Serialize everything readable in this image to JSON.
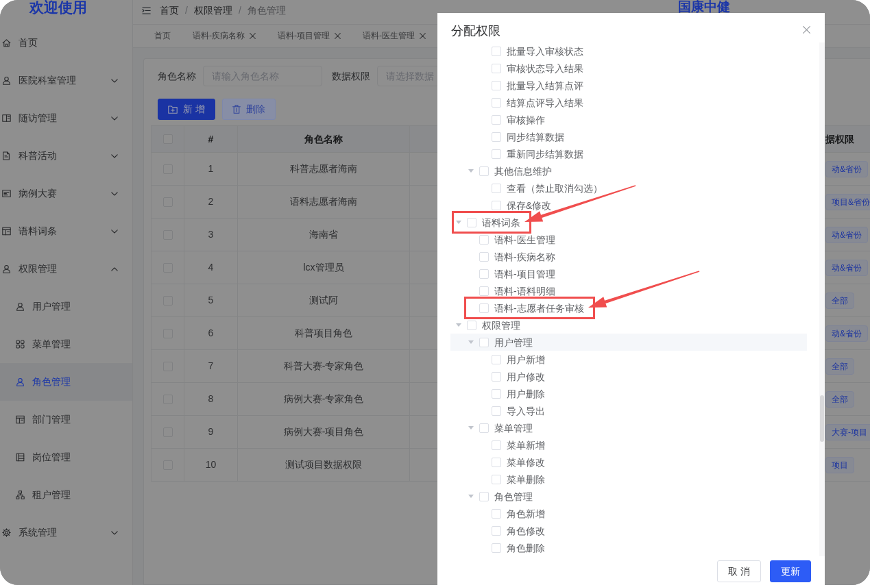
{
  "sidebar": {
    "logo": "欢迎使用",
    "items": [
      {
        "label": "首页",
        "selected": false
      },
      {
        "label": "医院科室管理",
        "expanded": false,
        "selected": false
      },
      {
        "label": "随访管理",
        "expanded": false,
        "selected": false
      },
      {
        "label": "科普活动",
        "expanded": false,
        "selected": false
      },
      {
        "label": "病例大赛",
        "expanded": false,
        "selected": false
      },
      {
        "label": "语料词条",
        "expanded": false,
        "selected": false
      },
      {
        "label": "权限管理",
        "expanded": true,
        "selected": false,
        "children": [
          {
            "label": "用户管理",
            "selected": false
          },
          {
            "label": "菜单管理",
            "selected": false
          },
          {
            "label": "角色管理",
            "selected": true
          },
          {
            "label": "部门管理",
            "selected": false
          },
          {
            "label": "岗位管理",
            "selected": false
          },
          {
            "label": "租户管理",
            "selected": false
          }
        ]
      },
      {
        "label": "系统管理",
        "expanded": false,
        "selected": false
      }
    ]
  },
  "header": {
    "breadcrumb": [
      {
        "label": "首页",
        "current": false
      },
      {
        "label": "权限管理",
        "current": false
      },
      {
        "label": "角色管理",
        "current": true
      }
    ],
    "separators": [
      "/",
      "/"
    ],
    "brand": "国康中健"
  },
  "tabs": [
    {
      "label": "首页",
      "closable": false,
      "selected": false
    },
    {
      "label": "语料-疾病名称",
      "closable": true,
      "selected": false
    },
    {
      "label": "语料-项目管理",
      "closable": true,
      "selected": false
    },
    {
      "label": "语料-医生管理",
      "closable": true,
      "selected": false
    }
  ],
  "filters": [
    {
      "label": "角色名称",
      "placeholder": "请输入角色名称"
    },
    {
      "label": "数据权限",
      "placeholder": "请选择数据"
    }
  ],
  "toolbar": [
    {
      "label": "新 增",
      "disabled": false
    },
    {
      "label": "删除",
      "disabled": true
    }
  ],
  "table": {
    "header_checked": false,
    "columns": [
      "#",
      "角色名称",
      "据权限"
    ],
    "rows": [
      {
        "checked": false,
        "number": "1",
        "role_name": "科普志愿者海南",
        "data_permission": "动&省份"
      },
      {
        "checked": false,
        "number": "2",
        "role_name": "语料志愿者海南",
        "data_permission": "项目&省份"
      },
      {
        "checked": false,
        "number": "3",
        "role_name": "海南省",
        "data_permission": "动&省份"
      },
      {
        "checked": false,
        "number": "4",
        "role_name": "lcx管理员",
        "data_permission": "动&省份"
      },
      {
        "checked": false,
        "number": "5",
        "role_name": "测试阿",
        "data_permission": "全部"
      },
      {
        "checked": false,
        "number": "6",
        "role_name": "科普项目角色",
        "data_permission": "动&省份"
      },
      {
        "checked": false,
        "number": "7",
        "role_name": "科普大赛-专家角色",
        "data_permission": "全部"
      },
      {
        "checked": false,
        "number": "8",
        "role_name": "病例大赛-专家角色",
        "data_permission": "全部"
      },
      {
        "checked": false,
        "number": "9",
        "role_name": "病例大赛-项目角色",
        "data_permission": "大赛-项目"
      },
      {
        "checked": false,
        "number": "10",
        "role_name": "测试项目数据权限",
        "data_permission": "项目"
      }
    ]
  },
  "dialog": {
    "title": "分配权限",
    "tree": [
      {
        "children": [
          {
            "children": [
              {
                "label": "批量导入审核状态",
                "checked": false,
                "hovered": false,
                "marked": false
              },
              {
                "label": "审核状态导入结果",
                "checked": false,
                "hovered": false,
                "marked": false
              },
              {
                "label": "批量导入结算点评",
                "checked": false,
                "hovered": false,
                "marked": false
              },
              {
                "label": "结算点评导入结果",
                "checked": false,
                "hovered": false,
                "marked": false
              },
              {
                "label": "审核操作",
                "checked": false,
                "hovered": false,
                "marked": false
              },
              {
                "label": "同步结算数据",
                "checked": false,
                "hovered": false,
                "marked": false
              },
              {
                "label": "重新同步结算数据",
                "checked": false,
                "hovered": false,
                "marked": false
              }
            ]
          },
          {
            "label": "其他信息维护",
            "checked": false,
            "expanded": true,
            "hovered": false,
            "marked": false,
            "children": [
              {
                "label": "查看（禁止取消勾选）",
                "checked": false,
                "hovered": false,
                "marked": false
              },
              {
                "label": "保存&修改",
                "checked": false,
                "hovered": false,
                "marked": false
              }
            ]
          }
        ]
      },
      {
        "label": "语料词条",
        "checked": false,
        "expanded": true,
        "hovered": false,
        "marked": true,
        "children": [
          {
            "label": "语料-医生管理",
            "checked": false,
            "hovered": false,
            "marked": false
          },
          {
            "label": "语料-疾病名称",
            "checked": false,
            "hovered": false,
            "marked": false
          },
          {
            "label": "语料-项目管理",
            "checked": false,
            "hovered": false,
            "marked": false
          },
          {
            "label": "语料-语料明细",
            "checked": false,
            "hovered": false,
            "marked": false
          },
          {
            "label": "语料-志愿者任务审核",
            "checked": false,
            "hovered": false,
            "marked": true
          }
        ]
      },
      {
        "label": "权限管理",
        "checked": false,
        "expanded": true,
        "hovered": false,
        "marked": false,
        "children": [
          {
            "label": "用户管理",
            "checked": false,
            "expanded": true,
            "hovered": true,
            "marked": false,
            "children": [
              {
                "label": "用户新增",
                "checked": false,
                "hovered": false,
                "marked": false
              },
              {
                "label": "用户修改",
                "checked": false,
                "hovered": false,
                "marked": false
              },
              {
                "label": "用户删除",
                "checked": false,
                "hovered": false,
                "marked": false
              },
              {
                "label": "导入导出",
                "checked": false,
                "hovered": false,
                "marked": false
              }
            ]
          },
          {
            "label": "菜单管理",
            "checked": false,
            "expanded": true,
            "hovered": false,
            "marked": false,
            "children": [
              {
                "label": "菜单新增",
                "checked": false,
                "hovered": false,
                "marked": false
              },
              {
                "label": "菜单修改",
                "checked": false,
                "hovered": false,
                "marked": false
              },
              {
                "label": "菜单删除",
                "checked": false,
                "hovered": false,
                "marked": false
              }
            ]
          },
          {
            "label": "角色管理",
            "checked": false,
            "expanded": true,
            "hovered": false,
            "marked": false,
            "children": [
              {
                "label": "角色新增",
                "checked": false,
                "hovered": false,
                "marked": false
              },
              {
                "label": "角色修改",
                "checked": false,
                "hovered": false,
                "marked": false
              },
              {
                "label": "角色删除",
                "checked": false,
                "hovered": false,
                "marked": false
              }
            ]
          }
        ]
      }
    ],
    "buttons": [
      {
        "label": "取 消",
        "kind": "default"
      },
      {
        "label": "更新",
        "kind": "primary"
      }
    ]
  }
}
